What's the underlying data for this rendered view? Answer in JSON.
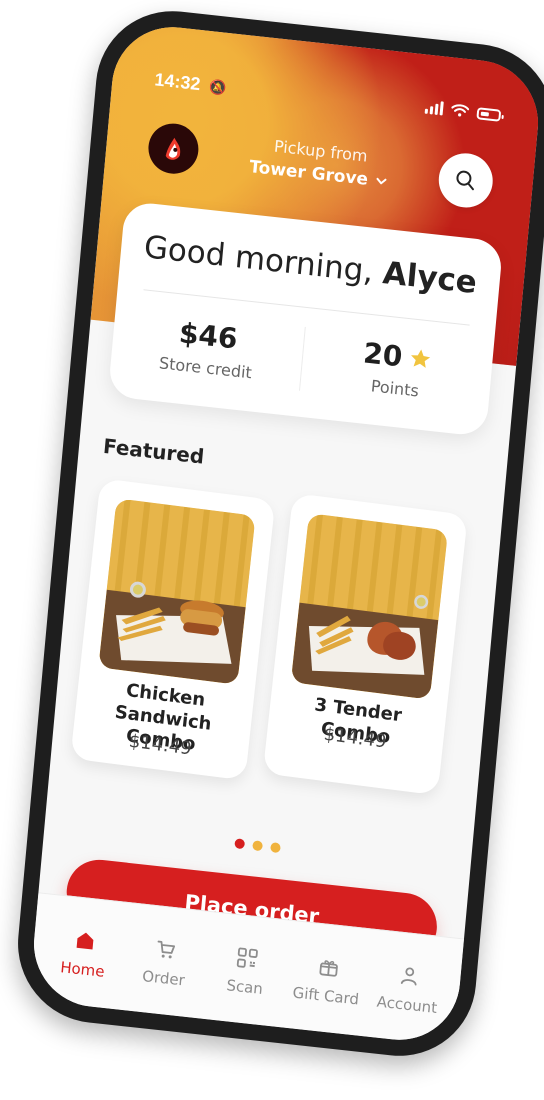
{
  "status_bar": {
    "time": "14:32",
    "bell_icon": "silent-bell-icon",
    "signal_icon": "cellular-signal-icon",
    "wifi_icon": "wifi-icon",
    "battery_icon": "battery-icon"
  },
  "header": {
    "pickup_label": "Pickup from",
    "store_name": "Tower Grove",
    "logo_icon": "brand-logo-icon",
    "chevron_icon": "chevron-down-icon",
    "search_icon": "search-icon"
  },
  "greeting_card": {
    "greeting_prefix": "Good morning,",
    "user_name": "Alyce",
    "store_credit_value": "$46",
    "store_credit_label": "Store credit",
    "points_value": "20",
    "points_label": "Points",
    "points_icon": "star-icon"
  },
  "featured": {
    "title": "Featured",
    "items": [
      {
        "name": "Chicken Sandwich Combo",
        "price": "$14.49",
        "image_icon": "chicken-sandwich-combo-image"
      },
      {
        "name": "3 Tender Combo",
        "price": "$14.49",
        "image_icon": "tender-combo-image"
      }
    ]
  },
  "pagination": {
    "dots": 3,
    "active_index": 0
  },
  "actions": {
    "place_order_label": "Place order"
  },
  "bottom_nav": [
    {
      "label": "Home",
      "icon": "home-icon",
      "active": true
    },
    {
      "label": "Order",
      "icon": "cart-icon",
      "active": false
    },
    {
      "label": "Scan",
      "icon": "qr-scan-icon",
      "active": false
    },
    {
      "label": "Gift Card",
      "icon": "gift-card-icon",
      "active": false
    },
    {
      "label": "Account",
      "icon": "account-icon",
      "active": false
    }
  ],
  "colors": {
    "accent_red": "#d61f1f",
    "accent_yellow": "#f0b33e",
    "text_dark": "#222222",
    "nav_inactive": "#8d8d8d"
  }
}
